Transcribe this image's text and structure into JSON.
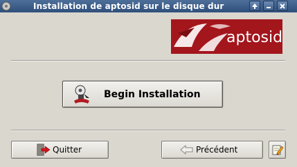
{
  "window": {
    "title": "Installation de aptosid sur le disque dur"
  },
  "logo": {
    "text": "aptosid",
    "colors": {
      "background": "#a3161c",
      "text": "#ffffff"
    }
  },
  "main": {
    "begin_label": "Begin Installation"
  },
  "footer": {
    "quit_label": "Quitter",
    "prev_label": "Précédent"
  },
  "colors": {
    "window_bg": "#dad7cf",
    "titlebar": "#3b5b86"
  }
}
